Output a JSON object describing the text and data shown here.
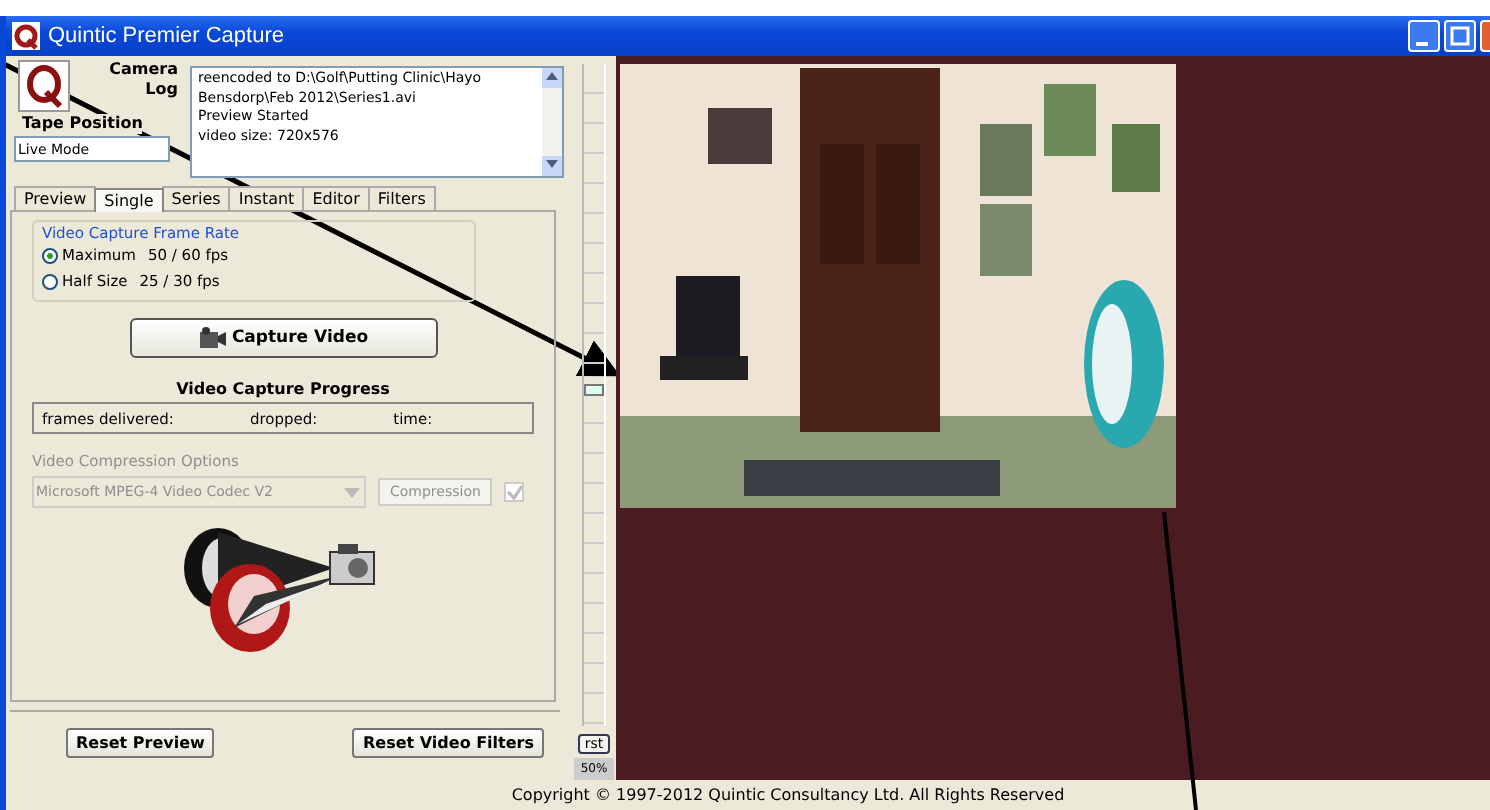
{
  "window": {
    "title": "Quintic Premier Capture"
  },
  "log": {
    "label_1": "Camera",
    "label_2": "Log",
    "lines": [
      "reencoded to D:\\Golf\\Putting Clinic\\Hayo",
      "Bensdorp\\Feb 2012\\Series1.avi",
      "Preview Started",
      "video size: 720x576"
    ]
  },
  "tape_position": {
    "label": "Tape Position",
    "value": "Live Mode"
  },
  "tabs": [
    {
      "label": "Preview",
      "selected": false
    },
    {
      "label": "Single",
      "selected": true
    },
    {
      "label": "Series",
      "selected": false
    },
    {
      "label": "Instant",
      "selected": false
    },
    {
      "label": "Editor",
      "selected": false
    },
    {
      "label": "Filters",
      "selected": false
    }
  ],
  "frame_rate": {
    "title": "Video Capture Frame Rate",
    "options": [
      {
        "label": "Maximum",
        "value": "50 / 60 fps",
        "selected": true
      },
      {
        "label": "Half Size",
        "value": "25 / 30 fps",
        "selected": false
      }
    ]
  },
  "capture_button": "Capture Video",
  "progress": {
    "title": "Video Capture Progress",
    "fields": [
      "frames delivered:",
      "dropped:",
      "time:"
    ]
  },
  "compression": {
    "title": "Video Compression Options",
    "disabled": true,
    "codec": "Microsoft MPEG-4 Video Codec V2",
    "button": "Compression",
    "checked": true
  },
  "buttons": [
    "Reset Preview",
    "Reset Video Filters"
  ],
  "zoom": {
    "button": "rst",
    "value": "50%",
    "level": 0.5
  },
  "status_bar": "Copyright © 1997-2012  Quintic Consultancy Ltd.   All Rights Reserved"
}
